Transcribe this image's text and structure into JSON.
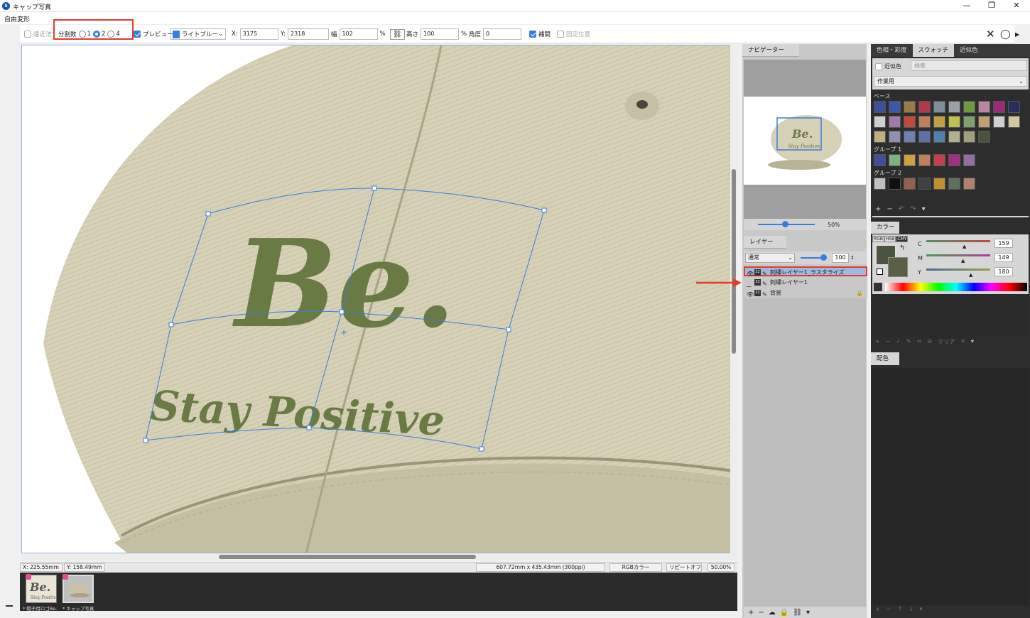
{
  "window": {
    "title": "キャップ写真",
    "minimize": "—",
    "maximize": "❐",
    "close": "✕"
  },
  "menu": {
    "label": "自由変形"
  },
  "toolbar": {
    "transparency": "遠近法",
    "divisions_label": "分割数",
    "div_options": [
      "1",
      "2",
      "4"
    ],
    "div_selected": "2",
    "preview": "プレビュー",
    "color_select": "ライトブルー",
    "x_label": "X:",
    "x_value": "3175",
    "y_label": "Y:",
    "y_value": "2318",
    "width_label": "幅",
    "width_value": "102",
    "width_unit": "%",
    "height_label": "高さ",
    "height_value": "100",
    "height_unit": "%",
    "angle_label": "角度",
    "angle_value": "0",
    "interpolate": "補間",
    "fixed_position": "固定位置",
    "cancel": "✕",
    "ok": "◯",
    "more": "▶"
  },
  "artwork": {
    "title": "Be.",
    "subtitle": "Stay Positive"
  },
  "status": {
    "x": "X: 225.55mm",
    "y": "Y: 158.49mm",
    "size": "607.72mm x 435.43mm (300ppi)",
    "mode": "RGBカラー",
    "repeat": "リピートオフ",
    "zoom": "50.00%"
  },
  "thumbs": [
    {
      "label": "* 帽子用ロゴBe..."
    },
    {
      "label": "* キャップ写真"
    }
  ],
  "navigator": {
    "title": "ナビゲーター",
    "zoom": "50%"
  },
  "layers": {
    "title": "レイヤー",
    "blend": "通常",
    "opacity": "100",
    "items": [
      {
        "name": "刺繍レイヤー1_ラスタライズ",
        "bits": "32"
      },
      {
        "name": "刺繍レイヤー1",
        "bits": "32"
      },
      {
        "name": "背景",
        "bits": "32"
      }
    ],
    "tools": [
      "+",
      "−",
      "☁",
      "🔒",
      "⛓",
      "▾"
    ]
  },
  "colorpanel": {
    "tabs": [
      "色相・彩度",
      "スウォッチ",
      "近似色"
    ],
    "near_color": "近似色",
    "search_placeholder": "検索",
    "set_select": "作業用",
    "groups": [
      "ベース",
      "グループ 1",
      "グループ 2"
    ],
    "colors_base": [
      "#3b4f9a",
      "#3d58a8",
      "#9b7a4a",
      "#b0384f",
      "#7d8d9a",
      "#9aa0a6",
      "#6f9a3f",
      "#b886a0",
      "#9a2b7a",
      "#2a2e5a",
      "#d0d0d0",
      "#a07aa8",
      "#c04a40",
      "#c08060",
      "#c0a040",
      "#c0c050",
      "#80a070",
      "#c0a070",
      "#d0d0d0",
      "#d0c8a0",
      "#c0b080",
      "#9090b0",
      "#7080b0",
      "#6070a8",
      "#5080b0",
      "#b0b090",
      "#a0a080",
      "#4a5540"
    ],
    "colors_g1": [
      "#4050a0",
      "#80b080",
      "#d0a040",
      "#c08060",
      "#c04050",
      "#a03080",
      "#9070a0"
    ],
    "colors_g2": [
      "#c0c0c0",
      "#101010",
      "#906050",
      "#404040",
      "#c09030",
      "#607060",
      "#b08070"
    ],
    "swatch_tools": [
      "+",
      "−",
      "↶",
      "↷",
      "▾"
    ],
    "color_title": "カラー",
    "models": [
      "RGB",
      "HSB",
      "CMY"
    ],
    "channels": [
      {
        "name": "C",
        "value": "159"
      },
      {
        "name": "M",
        "value": "149"
      },
      {
        "name": "Y",
        "value": "180"
      }
    ],
    "fg_color": "#4a5440",
    "bg_color": "#5a6045",
    "mini_tools": [
      "+",
      "−",
      "✓",
      "✎",
      "⇔",
      "⊘",
      "クリア",
      "✳",
      "▾"
    ],
    "palette_title": "配色",
    "palette_tools": [
      "+",
      "−",
      "↑",
      "↓",
      "▾"
    ]
  },
  "accent": "#3b7ddd",
  "highlight": "#e53b2a"
}
